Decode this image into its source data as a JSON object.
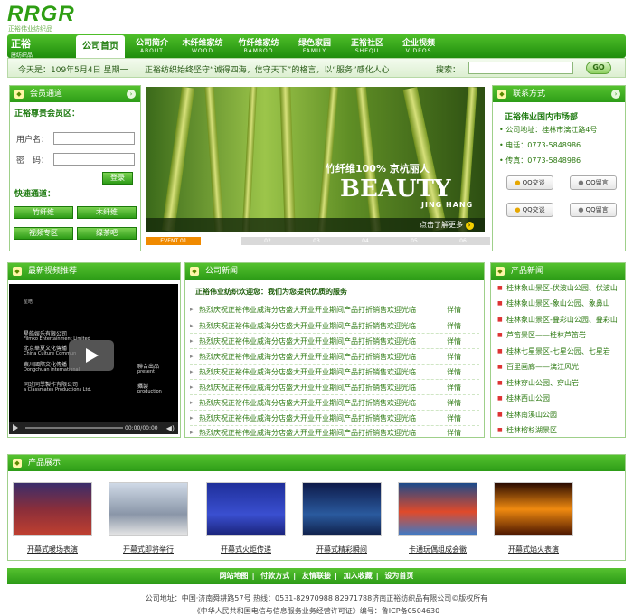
{
  "header": {
    "logo": "RRGR",
    "logo_sub": "正裕伟业纺织品",
    "brand": "正裕",
    "brand_sub": "唐纺织品"
  },
  "nav": [
    {
      "label": "公司首页",
      "en": ""
    },
    {
      "label": "公司简介",
      "en": "ABOUT"
    },
    {
      "label": "木纤维家纺",
      "en": "WOOD"
    },
    {
      "label": "竹纤维家纺",
      "en": "BAMBOO"
    },
    {
      "label": "绿色家园",
      "en": "FAMILY"
    },
    {
      "label": "正裕社区",
      "en": "SHEQU"
    },
    {
      "label": "企业视频",
      "en": "VIDEOS"
    }
  ],
  "infobar": {
    "date": "今天是：109年5月4日  星期一",
    "slogan": "正裕纺织始终坚守“诚得四海，信守天下”的格言，以“服务”感化人心",
    "search_label": "搜索：",
    "search_value": "",
    "go": "GO"
  },
  "member": {
    "title": "会员通道",
    "subtitle": "正裕尊贵会员区：",
    "username_label": "用户名：",
    "password_label": "密　码：",
    "login": "登录",
    "quick_title": "快速通道：",
    "quick": [
      "竹纤维",
      "木纤维",
      "视频专区",
      "绿茶吧"
    ]
  },
  "banner": {
    "cn": "竹纤维100% 京杭丽人",
    "en": "BEAUTY",
    "sub": "JING HANG",
    "more": "点击了解更多",
    "tabs": [
      "EVENT 01",
      "02",
      "03",
      "04",
      "05",
      "06"
    ]
  },
  "contact": {
    "title": "联系方式",
    "company": "正裕伟业国内市场部",
    "address": "公司地址：桂林市漓江路4号",
    "phone": "电话：0773-5848986",
    "fax": "传真：0773-5848986",
    "qq": [
      "QQ交谈",
      "QQ留言",
      "QQ交谈",
      "QQ留言"
    ]
  },
  "video": {
    "title": "最新视频推荐",
    "credits": [
      "星皓娱乐有限公司",
      "Filmko Entertainment Limited",
      "北京華夏文化傳播",
      "China Culture Commun",
      "東川國際文化傳播",
      "Dongchuan international",
      "同班同學製作有限公司",
      "a Classmates Productions Ltd.",
      "聯合出品",
      "present",
      "攝製",
      "production"
    ],
    "time": "00:00/00:00"
  },
  "news": {
    "title": "公司新闻",
    "headline": "正裕伟业纺织欢迎您：我们为您提供优质的服务",
    "items": [
      "热烈庆祝正裕伟业威海分店盛大开业开业期间产品打折销售欢迎光临",
      "热烈庆祝正裕伟业威海分店盛大开业开业期间产品打折销售欢迎光临",
      "热烈庆祝正裕伟业威海分店盛大开业开业期间产品打折销售欢迎光临",
      "热烈庆祝正裕伟业威海分店盛大开业开业期间产品打折销售欢迎光临",
      "热烈庆祝正裕伟业威海分店盛大开业开业期间产品打折销售欢迎光临",
      "热烈庆祝正裕伟业威海分店盛大开业开业期间产品打折销售欢迎光临",
      "热烈庆祝正裕伟业威海分店盛大开业开业期间产品打折销售欢迎光临",
      "热烈庆祝正裕伟业威海分店盛大开业开业期间产品打折销售欢迎光临",
      "热烈庆祝正裕伟业威海分店盛大开业开业期间产品打折销售欢迎光临"
    ],
    "detail": "详情"
  },
  "product_news": {
    "title": "产品新闻",
    "items": [
      "桂林象山景区-伏波山公园、伏波山",
      "桂林象山景区-象山公园、象鼻山",
      "桂林象山景区-叠彩山公园、叠彩山",
      "芦笛景区——桂林芦笛岩",
      "桂林七星景区-七星公园、七星岩",
      "百里画廊——漓江风光",
      "桂林穿山公园、穿山岩",
      "桂林西山公园",
      "桂林南溪山公园",
      "桂林榕杉湖景区"
    ]
  },
  "products": {
    "title": "产品展示",
    "items": [
      "开幕式暖场表演",
      "开幕式即将举行",
      "开幕式火炬传递",
      "开幕式精彩瞬间",
      "卡通玩偶组成会徽",
      "开幕式焰火表演"
    ]
  },
  "footer": {
    "links": [
      "网站地图",
      "付款方式",
      "友情联接",
      "加入收藏",
      "设为首页"
    ],
    "line1": "公司地址：中国·济南舜耕路57号 热线：0531-82970988 82971788济南正裕纺织品有限公司©版权所有",
    "line2": "《中华人民共和国电信与信息服务业务经营许可证》编号：鲁ICP备0504630"
  }
}
